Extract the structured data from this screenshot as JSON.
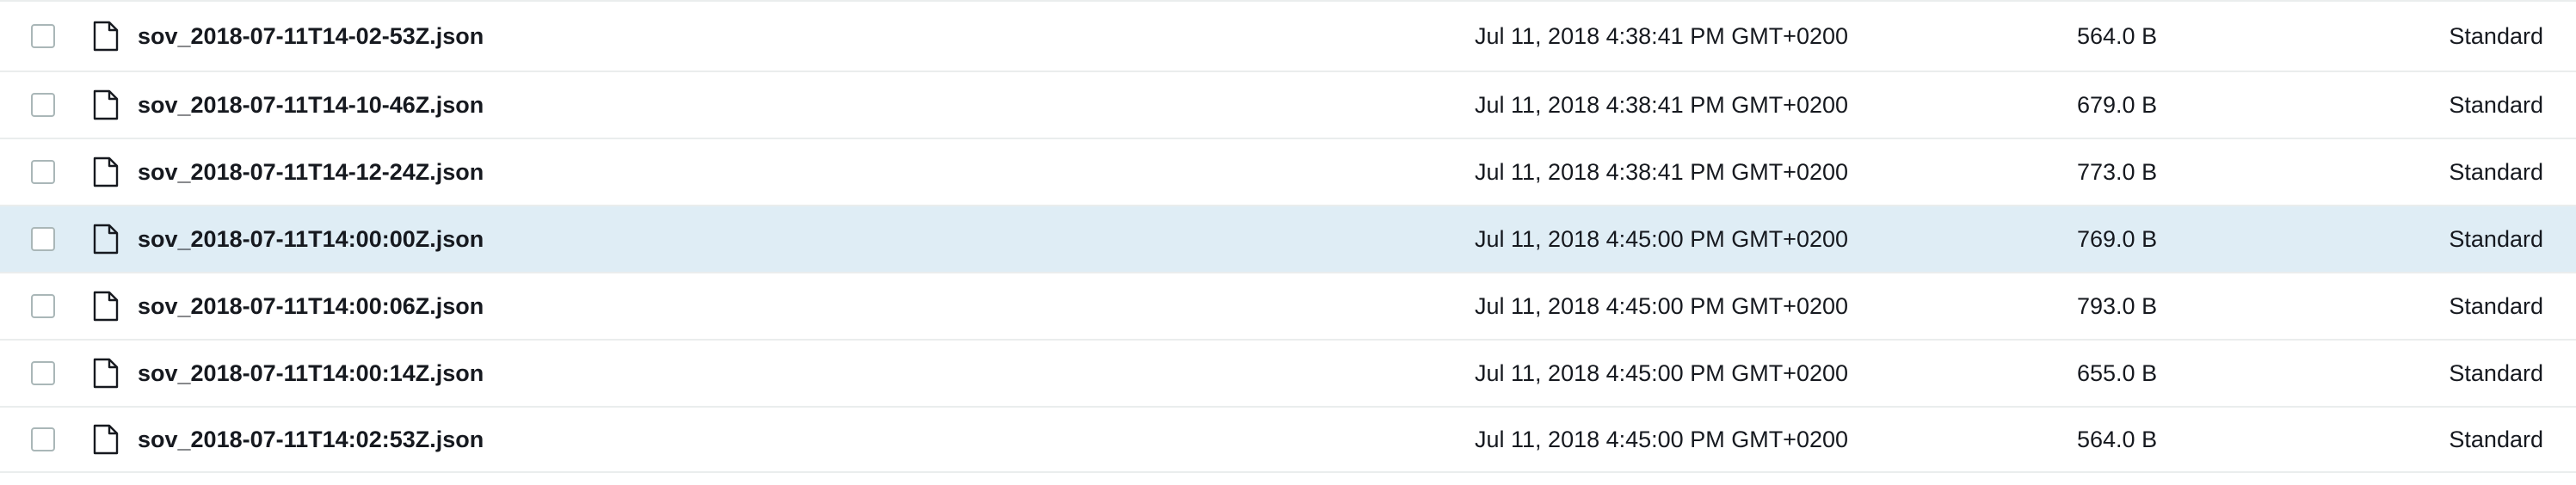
{
  "files": [
    {
      "name": "sov_2018-07-11T14-02-53Z.json",
      "last_modified": "Jul 11, 2018 4:38:41 PM GMT+0200",
      "size": "564.0 B",
      "storage_class": "Standard",
      "selected": false
    },
    {
      "name": "sov_2018-07-11T14-10-46Z.json",
      "last_modified": "Jul 11, 2018 4:38:41 PM GMT+0200",
      "size": "679.0 B",
      "storage_class": "Standard",
      "selected": false
    },
    {
      "name": "sov_2018-07-11T14-12-24Z.json",
      "last_modified": "Jul 11, 2018 4:38:41 PM GMT+0200",
      "size": "773.0 B",
      "storage_class": "Standard",
      "selected": false
    },
    {
      "name": "sov_2018-07-11T14:00:00Z.json",
      "last_modified": "Jul 11, 2018 4:45:00 PM GMT+0200",
      "size": "769.0 B",
      "storage_class": "Standard",
      "selected": true
    },
    {
      "name": "sov_2018-07-11T14:00:06Z.json",
      "last_modified": "Jul 11, 2018 4:45:00 PM GMT+0200",
      "size": "793.0 B",
      "storage_class": "Standard",
      "selected": false
    },
    {
      "name": "sov_2018-07-11T14:00:14Z.json",
      "last_modified": "Jul 11, 2018 4:45:00 PM GMT+0200",
      "size": "655.0 B",
      "storage_class": "Standard",
      "selected": false
    },
    {
      "name": "sov_2018-07-11T14:02:53Z.json",
      "last_modified": "Jul 11, 2018 4:45:00 PM GMT+0200",
      "size": "564.0 B",
      "storage_class": "Standard",
      "selected": false
    }
  ],
  "icons": {
    "checkbox": "checkbox-icon",
    "file": "file-icon"
  },
  "colors": {
    "selected_row": "#dfedf5",
    "divider": "#eaeded",
    "text": "#16191f"
  }
}
